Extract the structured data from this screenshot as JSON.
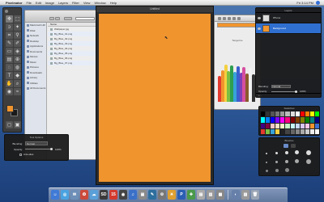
{
  "menubar": {
    "apple_glyph": "",
    "app_name": "Pixelmator",
    "items": [
      "File",
      "Edit",
      "Image",
      "Layers",
      "Filter",
      "View",
      "Window",
      "Help"
    ],
    "clock": "Fri 3:14 PM"
  },
  "canvas_window": {
    "title": "Untitled",
    "fill_color": "#f0942e"
  },
  "finder": {
    "sidebar": [
      "Macintosh HD",
      "iDisk",
      "Network",
      "Desktop",
      "Applications",
      "Documents",
      "Movies",
      "Music",
      "Pictures",
      "Downloads",
      "Library",
      "Utilities",
      "All Documents"
    ],
    "header": "Name",
    "files": [
      "Wallpaper.jpg",
      "Bg_Blue_01.png",
      "Bg_Blue_02.png",
      "Bg_Blue_03.png",
      "Bg_Blue_04.png",
      "Bg_Blue_05.png",
      "Bg_Blue_06.png",
      "Bg_Blue_07.png"
    ]
  },
  "crayon_picker": {
    "label": "Tangerine",
    "current_color": "#f0942e",
    "crayons": [
      "#e23a2e",
      "#f0942e",
      "#f4d03f",
      "#7bc043",
      "#2e9e4f",
      "#37a2d8",
      "#3a5fcd",
      "#7d3fb8",
      "#d64fa0",
      "#8a5a2b",
      "#f2f2f2",
      "#333333"
    ]
  },
  "layers": {
    "title": "Layers",
    "items": [
      {
        "name": "iPhone",
        "thumb": "#dddddd"
      },
      {
        "name": "Background",
        "thumb": "#f0942e"
      }
    ],
    "blending_label": "Blending:",
    "blending_value": "Normal",
    "opacity_label": "Opacity:",
    "opacity_value": "100%",
    "footer": "+  -"
  },
  "swatches": {
    "title": "Swatches",
    "colors": [
      "#000000",
      "#333333",
      "#555555",
      "#777777",
      "#999999",
      "#bbbbbb",
      "#dddddd",
      "#ffffff",
      "#ff0000",
      "#ff8000",
      "#ffff00",
      "#00ff00",
      "#00ffff",
      "#0080ff",
      "#0000ff",
      "#8000ff",
      "#ff00ff",
      "#ff0080",
      "#800000",
      "#804000",
      "#808000",
      "#008000",
      "#008080",
      "#000080",
      "#400080",
      "#800040",
      "#f7c6c6",
      "#f7e0c6",
      "#f7f7c6",
      "#c6f7c6",
      "#c6f7f7",
      "#c6d8f7",
      "#d8c6f7",
      "#f7c6e6",
      "#f0942e",
      "#3a6fd0",
      "#e23a2e",
      "#7bc043",
      "#37a2d8",
      "#f4d03f",
      "#222222",
      "#444444",
      "#666666",
      "#888888",
      "#aaaaaa",
      "#cccccc",
      "#eeeeee",
      "#fafafa"
    ]
  },
  "brushes": {
    "title": "Brushes"
  },
  "tool_options": {
    "title": "Tool Options",
    "blending_label": "Blending:",
    "blending_value": "Normal",
    "opacity_label": "Opacity:",
    "opacity_value": "100%",
    "antialias_label": "Anti-alias"
  },
  "dock": {
    "apps": [
      {
        "glyph": "☺",
        "color": "#3f7ad6"
      },
      {
        "glyph": "◎",
        "color": "#4aa3e0"
      },
      {
        "glyph": "✉",
        "color": "#6d8fb8"
      },
      {
        "glyph": "✪",
        "color": "#cc4a3a"
      },
      {
        "glyph": "☁",
        "color": "#5aa0d8"
      },
      {
        "glyph": "SD",
        "color": "#3b3b3b"
      },
      {
        "glyph": "15",
        "color": "#d23a2e"
      },
      {
        "glyph": "◉",
        "color": "#444444"
      },
      {
        "glyph": "♫",
        "color": "#3a70c8"
      },
      {
        "glyph": "▣",
        "color": "#8a8a8a"
      },
      {
        "glyph": "✎",
        "color": "#2d6f9e"
      },
      {
        "glyph": "⚙",
        "color": "#777777"
      },
      {
        "glyph": "☀",
        "color": "#e0a030"
      },
      {
        "glyph": "P",
        "color": "#2a5fb5"
      },
      {
        "glyph": "✚",
        "color": "#4a9a4a"
      },
      {
        "glyph": "▤",
        "color": "#aaaaaa"
      },
      {
        "glyph": "▥",
        "color": "#999999"
      },
      {
        "glyph": "▦",
        "color": "#888888"
      },
      {
        "glyph": "◐",
        "color": "#6680aa"
      },
      {
        "glyph": "▧",
        "color": "#9a9a9a"
      },
      {
        "glyph": "🗑",
        "color": "#9aa5b5"
      }
    ]
  }
}
